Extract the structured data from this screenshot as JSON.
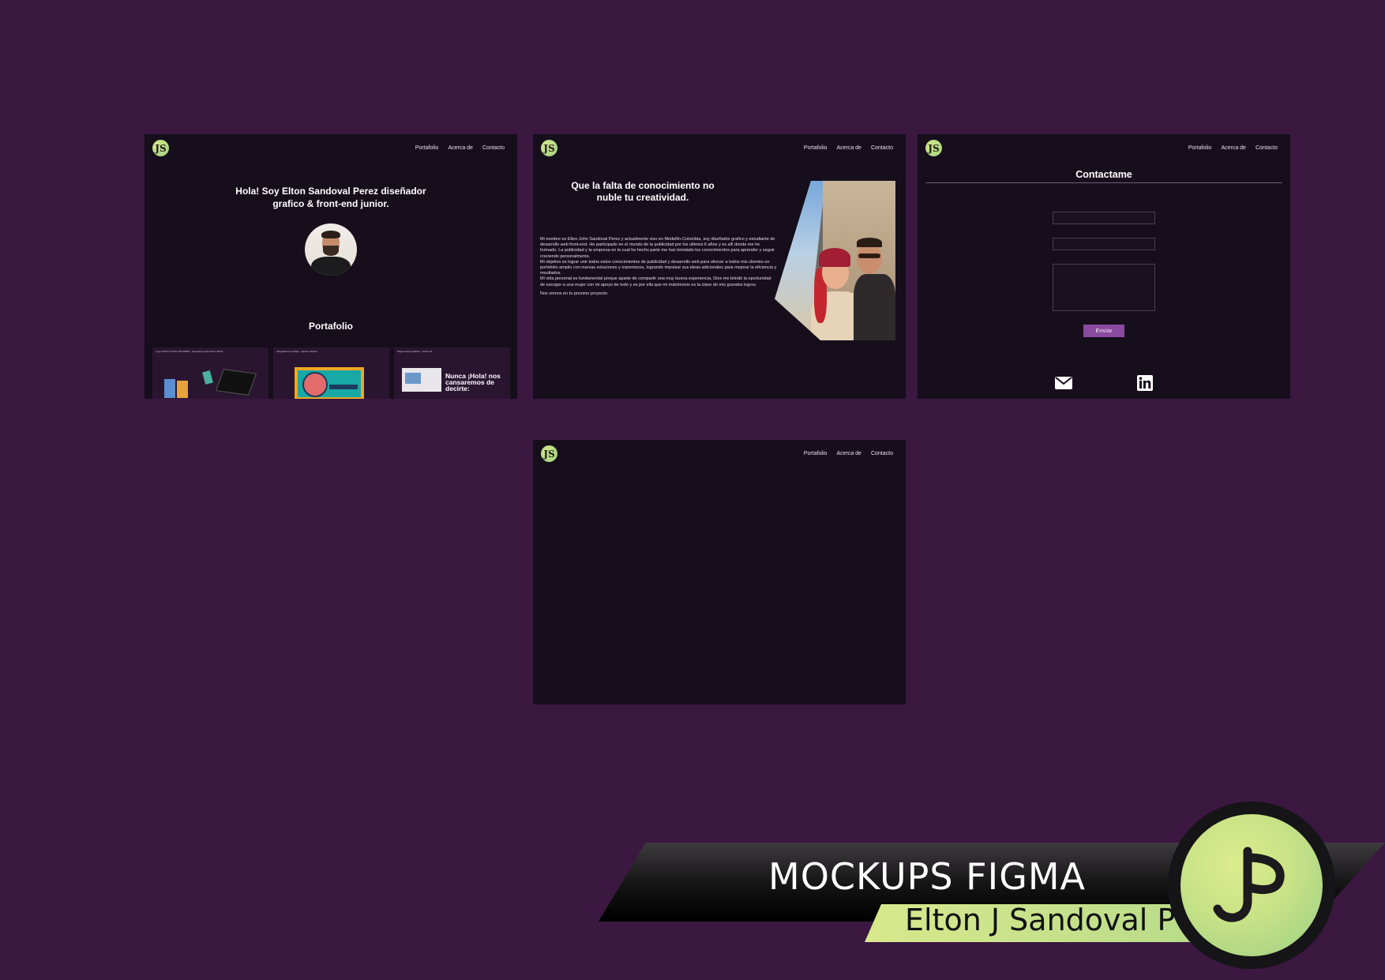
{
  "nav": [
    "Portafolio",
    "Acerca de",
    "Contacto"
  ],
  "logo_glyph": "JS",
  "board1": {
    "hero_line1": "Hola!  Soy Elton Sandoval Perez diseñador",
    "hero_line2": "grafico & front-end junior.",
    "portfolio_title": "Portafolio",
    "thumbs": [
      {
        "caption": "Logo HAPPY FOOD CHILDREN - Ilustración para marca infantil"
      },
      {
        "caption": "Infografía de reciclaje - diseño editorial"
      },
      {
        "caption": "Página web portafolio - diseño UI",
        "big_text": "Nunca ¡Hola! nos cansaremos de decirte:"
      }
    ]
  },
  "board2": {
    "quote_line1": "Que la falta de conocimiento no",
    "quote_line2": "nuble tu creatividad.",
    "about_paragraphs": [
      "Mi nombre es Elton John Sandoval Perez y actualmente vivo en Medellín-Colombia, soy diseñador grafico y estudiante de desarrollo web front-end. He participado en el mundo de la publicidad por los ultimos 6 años y es allí donde me he formado. La publicidad y la empresa en la cual he hecho parte me han brindado los conocimientos para aprender y seguir creciendo personalmente.",
      "Mi objetivo es lograr unir todos estos conocimientos de publicidad y desarrollo web para ofrecer a todos mis clientes un portafolio amplio con nuevas soluciones y experiencia, logrando impulsar sus ideas adicionales para mejorar la eficiencia y resultados.",
      "Mi vida personal es fundamental porque aparte de compartir una muy buena experiencia, Dios me brindó la oportunidad de escoger a una mujer con mi apoyo de todo y es por ella que mi matrimonio es la clave de mis grandes logros.",
      "Nos vemos en tu proximo proyecto."
    ]
  },
  "board3": {
    "title": "Contactame",
    "send_label": "Enviar"
  },
  "banner": {
    "title": "MOCKUPS FIGMA",
    "subtitle": "Elton J Sandoval P"
  },
  "colors": {
    "background": "#3a1840",
    "board": "#160e1b",
    "accent_purple": "#8a4aa0",
    "logo_green": "#c8e286"
  }
}
